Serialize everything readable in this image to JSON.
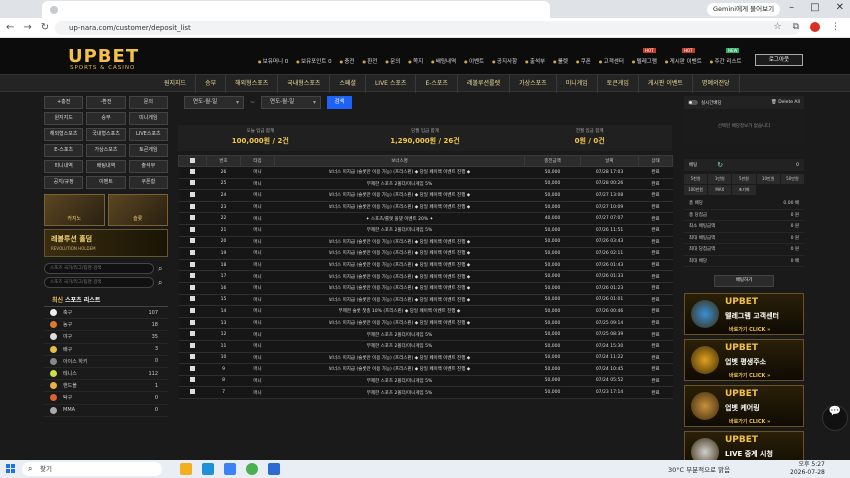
{
  "browser": {
    "url": "up-nara.com/customer/deposit_list",
    "gemini_button": "Gemini에게 물어보기"
  },
  "site": {
    "logo": "UPBET",
    "logo_sub": "SPORTS & CASINO",
    "top_nav": [
      "보유머니 0",
      "보유포인트 0",
      "충전",
      "환전",
      "문의",
      "쪽지",
      "배팅내역",
      "이벤트",
      "공지사항",
      "출석부",
      "룰렛",
      "쿠폰",
      "고객센터",
      "텔레그램",
      "게시판 이벤트",
      "주간 리스트"
    ],
    "login_button": "로그아웃",
    "hot_label": "HOT",
    "new_label": "NEW",
    "main_nav": [
      "원지지드",
      "승부",
      "해외형스포츠",
      "국내형스포츠",
      "스페셜",
      "LIVE 스포츠",
      "E-스포츠",
      "레볼루션룰렛",
      "가상스포츠",
      "미니게임",
      "토큰게임",
      "게시판 이벤트",
      "명예의전당"
    ]
  },
  "sidebar": {
    "quick_buttons": [
      "+충전",
      "-환전",
      "문의",
      "원지지드",
      "승부",
      "미니게임",
      "해외형스포츠",
      "국내형스포츠",
      "LIVE스포츠",
      "E-스포츠",
      "가상스포츠",
      "토큰게임",
      "미니내역",
      "배팅내역",
      "출석부",
      "공지/규정",
      "이벤트",
      "쿠폰함"
    ],
    "banner_left": "카지노",
    "banner_right": "슬롯",
    "banner_wide_title": "레볼루션 홀덤",
    "banner_wide_sub": "REVOLUTION HOLDEM",
    "search_placeholder_1": "스포츠 국가/리그/팀명 검색",
    "search_placeholder_2": "스포츠 국가/리그/팀명 검색",
    "sports_title_prefix": "최신",
    "sports_title": "스포츠 리스트",
    "sports": [
      {
        "name": "축구",
        "count": "107",
        "color": "#eeeeee"
      },
      {
        "name": "농구",
        "count": "18",
        "color": "#e07a2b"
      },
      {
        "name": "야구",
        "count": "35",
        "color": "#dddddd"
      },
      {
        "name": "배구",
        "count": "3",
        "color": "#e0c040"
      },
      {
        "name": "아이스 하키",
        "count": "0",
        "color": "#888888"
      },
      {
        "name": "테니스",
        "count": "112",
        "color": "#c8e04a"
      },
      {
        "name": "핸드볼",
        "count": "1",
        "color": "#e8b040"
      },
      {
        "name": "탁구",
        "count": "0",
        "color": "#e06030"
      },
      {
        "name": "MMA",
        "count": "0",
        "color": "#aaaaaa"
      }
    ]
  },
  "filter": {
    "date_from": "연도-월-일",
    "date_to": "연도-월-일",
    "separator": "~",
    "search_button": "검색"
  },
  "summary": [
    {
      "label": "오늘 입금 합계",
      "value": "100,000원 / 2건"
    },
    {
      "label": "당월 입금 합계",
      "value": "1,290,000원 / 26건"
    },
    {
      "label": "전월 입금 합계",
      "value": "0원 / 0건"
    }
  ],
  "table": {
    "headers": [
      "",
      "번호",
      "타입",
      "보너스명",
      "충전금액",
      "날짜",
      "상태"
    ],
    "rows": [
      {
        "no": "26",
        "type": "머니",
        "bonus": "보너스 미지급 (슬롯만 이용 가능) (프리스핀) ◆ 당일 페이백 이벤트 진행 ◆",
        "amount": "50,000",
        "date": "07/28 17:03",
        "status": "완료"
      },
      {
        "no": "25",
        "type": "머니",
        "bonus": "무제한 스포츠 2폴더/미니게임 5%",
        "amount": "50,000",
        "date": "07/28 00:26",
        "status": "완료"
      },
      {
        "no": "24",
        "type": "머니",
        "bonus": "보너스 미지급 (슬롯만 이용 가능) (프리스핀) ◆ 당일 페이백 이벤트 진행 ◆",
        "amount": "50,000",
        "date": "07/27 13:08",
        "status": "완료"
      },
      {
        "no": "23",
        "type": "머니",
        "bonus": "보너스 미지급 (슬롯만 이용 가능) (프리스핀) ◆ 당일 페이백 이벤트 진행 ◆",
        "amount": "50,000",
        "date": "07/27 10:09",
        "status": "완료"
      },
      {
        "no": "22",
        "type": "머니",
        "bonus": "✦ 스포츠/룰렛 올댓 이벤트 20% ✦",
        "amount": "40,000",
        "date": "07/27 07:07",
        "status": "완료"
      },
      {
        "no": "21",
        "type": "머니",
        "bonus": "무제한 스포츠 2폴더/미니게임 5%",
        "amount": "50,000",
        "date": "07/26 11:51",
        "status": "완료"
      },
      {
        "no": "20",
        "type": "머니",
        "bonus": "보너스 미지급 (슬롯만 이용 가능) (프리스핀) ◆ 당일 페이백 이벤트 진행 ◆",
        "amount": "50,000",
        "date": "07/26 03:43",
        "status": "완료"
      },
      {
        "no": "19",
        "type": "머니",
        "bonus": "보너스 미지급 (슬롯만 이용 가능) (프리스핀) ◆ 당일 페이백 이벤트 진행 ◆",
        "amount": "50,000",
        "date": "07/26 02:11",
        "status": "완료"
      },
      {
        "no": "18",
        "type": "머니",
        "bonus": "보너스 미지급 (슬롯만 이용 가능) (프리스핀) ◆ 당일 페이백 이벤트 진행 ◆",
        "amount": "50,000",
        "date": "07/26 01:43",
        "status": "완료"
      },
      {
        "no": "17",
        "type": "머니",
        "bonus": "보너스 미지급 (슬롯만 이용 가능) (프리스핀) ◆ 당일 페이백 이벤트 진행 ◆",
        "amount": "50,000",
        "date": "07/26 01:33",
        "status": "완료"
      },
      {
        "no": "16",
        "type": "머니",
        "bonus": "보너스 미지급 (슬롯만 이용 가능) (프리스핀) ◆ 당일 페이백 이벤트 진행 ◆",
        "amount": "50,000",
        "date": "07/26 01:23",
        "status": "완료"
      },
      {
        "no": "15",
        "type": "머니",
        "bonus": "보너스 미지급 (슬롯만 이용 가능) (프리스핀) ◆ 당일 페이백 이벤트 진행 ◆",
        "amount": "50,000",
        "date": "07/26 01:01",
        "status": "완료"
      },
      {
        "no": "14",
        "type": "머니",
        "bonus": "무제한 슬롯 첫충 10% (프리스핀) ◆ 당일 페이백 이벤트 진행 ◆",
        "amount": "50,000",
        "date": "07/26 00:46",
        "status": "완료"
      },
      {
        "no": "13",
        "type": "머니",
        "bonus": "보너스 미지급 (슬롯만 이용 가능) (프리스핀) ◆ 당일 페이백 이벤트 진행 ◆",
        "amount": "50,000",
        "date": "07/25 09:14",
        "status": "완료"
      },
      {
        "no": "12",
        "type": "머니",
        "bonus": "무제한 스포츠 2폴더/미니게임 5%",
        "amount": "50,000",
        "date": "07/25 08:39",
        "status": "완료"
      },
      {
        "no": "11",
        "type": "머니",
        "bonus": "무제한 스포츠 2폴더/미니게임 5%",
        "amount": "50,000",
        "date": "07/24 15:30",
        "status": "완료"
      },
      {
        "no": "10",
        "type": "머니",
        "bonus": "보너스 미지급 (슬롯만 이용 가능) (프리스핀) ◆ 당일 페이백 이벤트 진행 ◆",
        "amount": "50,000",
        "date": "07/24 11:22",
        "status": "완료"
      },
      {
        "no": "9",
        "type": "머니",
        "bonus": "보너스 미지급 (슬롯만 이용 가능) (프리스핀) ◆ 당일 페이백 이벤트 진행 ◆",
        "amount": "50,000",
        "date": "07/24 10:45",
        "status": "완료"
      },
      {
        "no": "8",
        "type": "머니",
        "bonus": "무제한 스포츠 2폴더/미니게임 5%",
        "amount": "50,000",
        "date": "07/24 05:52",
        "status": "완료"
      },
      {
        "no": "7",
        "type": "머니",
        "bonus": "무제한 스포츠 2폴더/미니게임 5%",
        "amount": "50,000",
        "date": "07/23 17:14",
        "status": "완료"
      }
    ]
  },
  "betslip": {
    "toggle_label": "실시간배당",
    "delete_all": "Delete All",
    "empty_message": "선택된 배당정보가 없습니다",
    "amount_label": "배팅",
    "amount_value": "0",
    "amount_buttons": [
      "5천원",
      "1만원",
      "5만원",
      "10만원",
      "50만원",
      "100만원",
      "MAX",
      "초기화"
    ],
    "info_rows": [
      {
        "label": "총 배당",
        "value": "0.00 배"
      },
      {
        "label": "총 당첨금",
        "value": "0 원"
      },
      {
        "label": "최소 배팅금액",
        "value": "0 원"
      },
      {
        "label": "최대 배팅금액",
        "value": "0 원"
      },
      {
        "label": "최대 당첨금액",
        "value": "0 원"
      },
      {
        "label": "최대 배당",
        "value": "0 배"
      }
    ],
    "bet_button": "배팅하기"
  },
  "promos": [
    {
      "logo": "UPBET",
      "title": "텔레그램 고객센터",
      "click": "바로가기  CLICK »",
      "color": "#3a8fd8"
    },
    {
      "logo": "UPBET",
      "title": "업벳 평생주소",
      "click": "바로가기  CLICK »",
      "color": "#e0a020"
    },
    {
      "logo": "UPBET",
      "title": "업벳 케어링",
      "click": "바로가기  CLICK »",
      "color": "#c89040"
    },
    {
      "logo": "UPBET",
      "title": "LIVE 중계 시청",
      "click": "바로가기  CLICK »",
      "color": "#d0d0d0"
    }
  ],
  "taskbar": {
    "search": "찾기",
    "weather": "30°C  부분적으로 맑음",
    "time": "오후 5:27",
    "date": "2026-07-28"
  }
}
